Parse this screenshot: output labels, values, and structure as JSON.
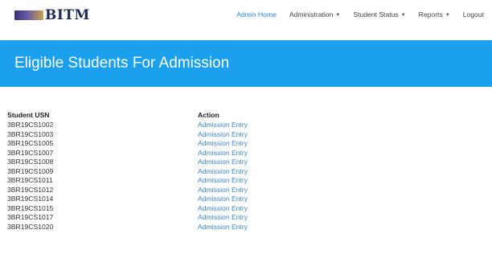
{
  "brand": {
    "text": "BITM",
    "logo_icon": "college-logo-icon"
  },
  "nav": {
    "items": [
      {
        "label": "Admin Home",
        "active": true,
        "dropdown": false
      },
      {
        "label": "Administration",
        "active": false,
        "dropdown": true
      },
      {
        "label": "Student Status",
        "active": false,
        "dropdown": true
      },
      {
        "label": "Reports",
        "active": false,
        "dropdown": true
      },
      {
        "label": "Logout",
        "active": false,
        "dropdown": false
      }
    ],
    "active_color": "#1e88e5"
  },
  "hero": {
    "title": "Eligible Students For Admission",
    "background": "#1aa0ec"
  },
  "table": {
    "headers": {
      "usn": "Student USN",
      "action": "Action"
    },
    "rows": [
      {
        "usn": "3BR19CS1002",
        "action": "Admission Entry"
      },
      {
        "usn": "3BR19CS1003",
        "action": "Admission Entry"
      },
      {
        "usn": "3BR19CS1005",
        "action": "Admission Entry"
      },
      {
        "usn": "3BR19CS1007",
        "action": "Admission Entry"
      },
      {
        "usn": "3BR19CS1008",
        "action": "Admission Entry"
      },
      {
        "usn": "3BR19CS1009",
        "action": "Admission Entry"
      },
      {
        "usn": "3BR19CS1011",
        "action": "Admission Entry"
      },
      {
        "usn": "3BR19CS1012",
        "action": "Admission Entry"
      },
      {
        "usn": "3BR19CS1014",
        "action": "Admission Entry"
      },
      {
        "usn": "3BR19CS1015",
        "action": "Admission Entry"
      },
      {
        "usn": "3BR19CS1017",
        "action": "Admission Entry"
      },
      {
        "usn": "3BR19CS1020",
        "action": "Admission Entry"
      }
    ],
    "link_color": "#3a86c8"
  }
}
